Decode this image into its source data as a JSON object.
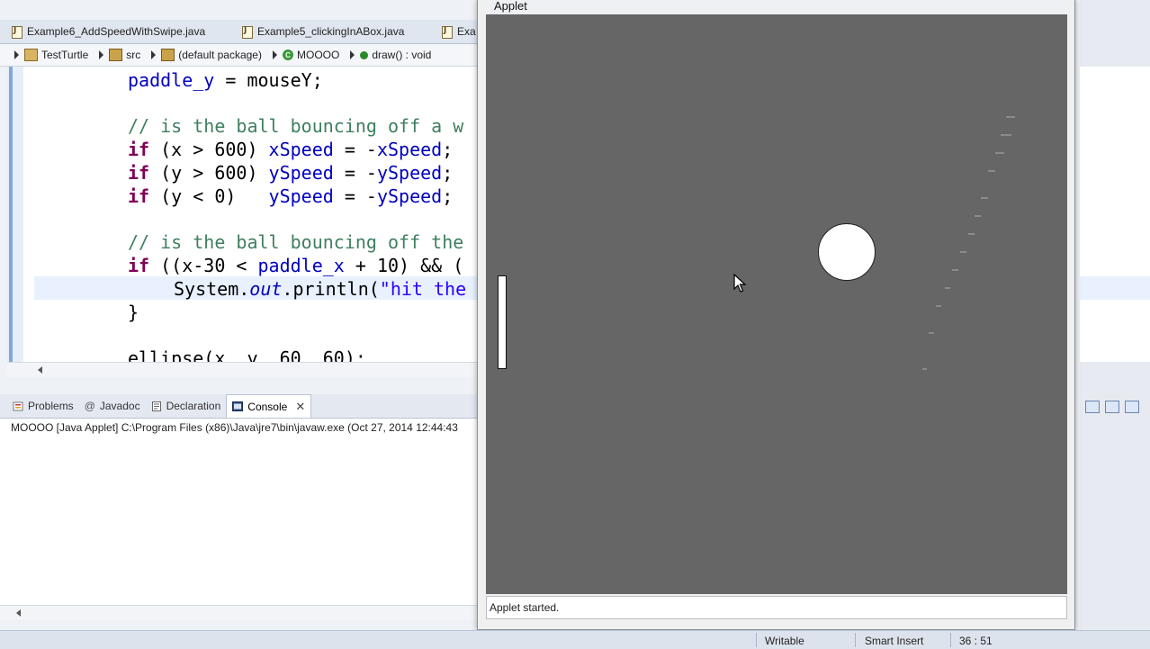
{
  "editor_tabs": [
    {
      "label": "Example6_AddSpeedWithSwipe.java"
    },
    {
      "label": "Example5_clickingInABox.java"
    },
    {
      "label": "Exa"
    }
  ],
  "breadcrumb": {
    "project": "TestTurtle",
    "src": "src",
    "package": "(default package)",
    "class": "MOOOO",
    "method": "draw() : void"
  },
  "code": {
    "line1_var": "paddle_y",
    "line1_rest": " = mouseY;",
    "comment1": "// is the ball bouncing off a w",
    "if1_cond": " (x > 600) ",
    "if1_assign": "xSpeed",
    "if1_eq": " = -",
    "if1_rhs": "xSpeed",
    "if1_end": ";",
    "if2_cond": " (y > 600) ",
    "if2_assign": "ySpeed",
    "if2_eq": " = -",
    "if2_rhs": "ySpeed",
    "if2_end": ";",
    "if3_cond": " (y < 0)   ",
    "if3_assign": "ySpeed",
    "if3_eq": " = -",
    "if3_rhs": "ySpeed",
    "if3_end": ";",
    "comment2": "// is the ball bouncing off the",
    "if4_cond": " ((x-30 < ",
    "if4_var": "paddle_x",
    "if4_rest": " + 10) && (",
    "sys_prefix": "System.",
    "sys_out": "out",
    "sys_call": ".println(",
    "sys_str": "\"hit the",
    "brace": "}",
    "ellipse": "ellipse(x, y, 60, 60);",
    "kw_if": "if"
  },
  "bottom_tabs": [
    {
      "label": "Problems"
    },
    {
      "label": "Javadoc"
    },
    {
      "label": "Declaration"
    },
    {
      "label": "Console"
    }
  ],
  "console": {
    "header": "MOOOO [Java Applet] C:\\Program Files (x86)\\Java\\jre7\\bin\\javaw.exe (Oct 27, 2014 12:44:43"
  },
  "applet": {
    "title": "Applet",
    "status": "Applet started."
  },
  "status_bar": {
    "writable": "Writable",
    "insert_mode": "Smart Insert",
    "position": "36 : 51"
  },
  "colors": {
    "canvas": "#666666",
    "keyword": "#7f0055",
    "field": "#0000c0",
    "comment": "#3f7f5f",
    "string": "#2a00ff"
  }
}
